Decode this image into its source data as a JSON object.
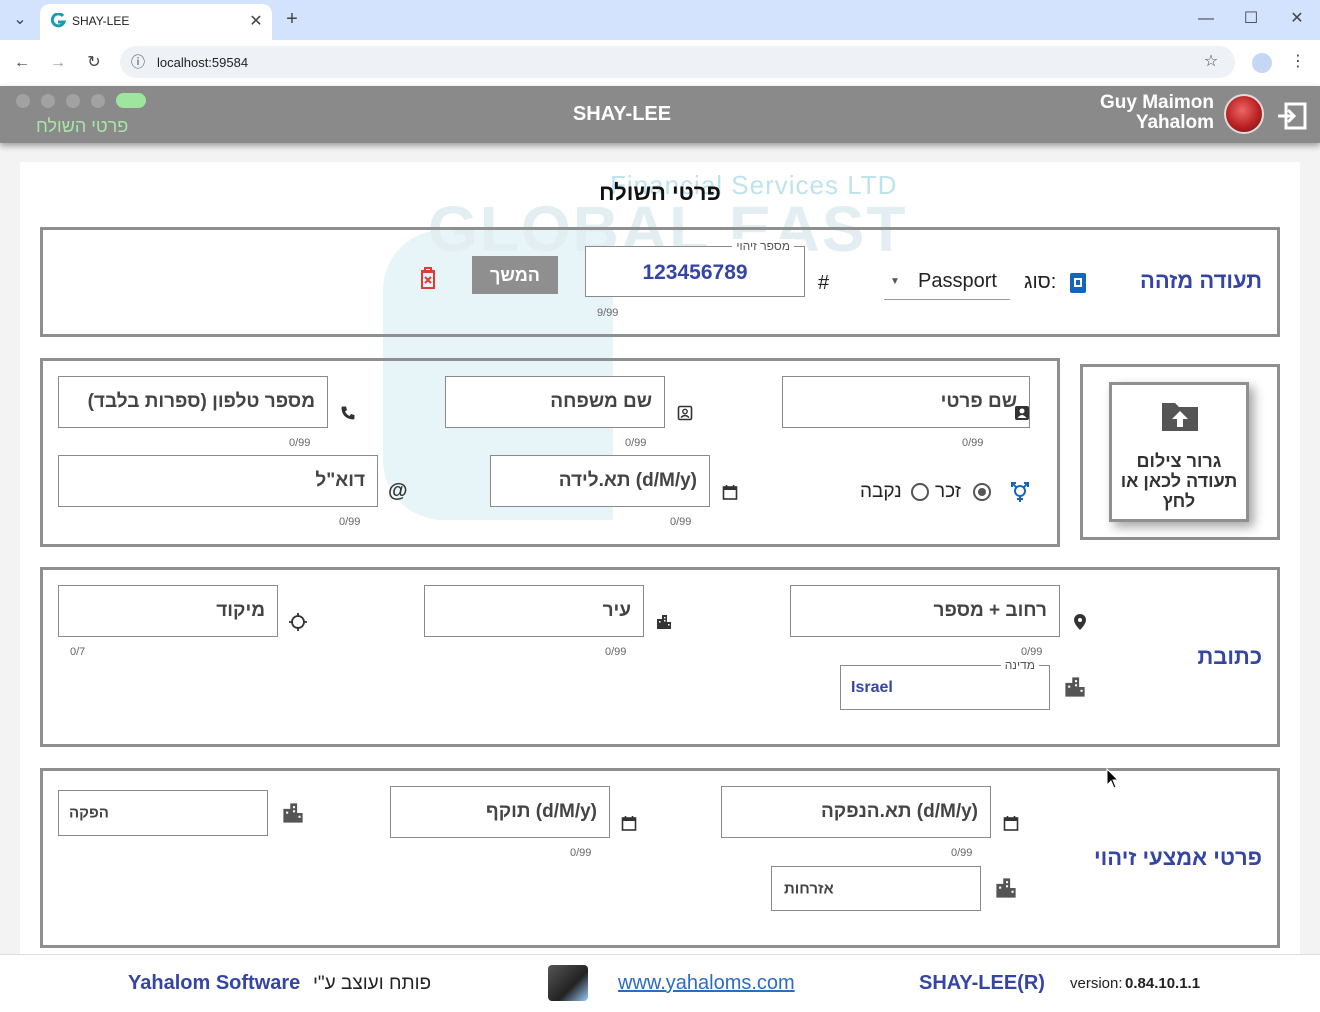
{
  "browser": {
    "tab_title": "SHAY-LEE",
    "url": "localhost:59584"
  },
  "header": {
    "page_subtitle": "פרטי השולח",
    "app_title": "SHAY-LEE",
    "user_first": "Guy Maimon",
    "user_last": "Yahalom"
  },
  "watermark": {
    "line1": "Financial Services LTD",
    "line2": "GLOBAL EAST"
  },
  "main_title": "פרטי השולח",
  "id_section": {
    "label": "תעודה מזהה",
    "type_label": "סוג:",
    "type_value": "Passport",
    "hash": "#",
    "id_legend": "מספר זיהוי",
    "id_value": "123456789",
    "id_counter": "9/99",
    "continue": "המשך"
  },
  "personal": {
    "first_name": "שם פרטי",
    "first_counter": "0/99",
    "last_name": "שם משפחה",
    "last_counter": "0/99",
    "phone": "מספר טלפון (ספרות בלבד)",
    "phone_counter": "0/99",
    "male": "זכר",
    "female": "נקבה",
    "birthdate": "תא.לידה (d/M/y)",
    "birth_counter": "0/99",
    "email": "דוא\"ל",
    "email_counter": "0/99"
  },
  "upload": {
    "text": "גרור צילום תעודה לכאן או לחץ"
  },
  "address": {
    "label": "כתובת",
    "street": "רחוב + מספר",
    "street_counter": "0/99",
    "city": "עיר",
    "city_counter": "0/99",
    "zip": "מיקוד",
    "zip_counter": "0/7",
    "country_legend": "מדינה",
    "country_value": "Israel"
  },
  "id_means": {
    "label": "פרטי אמצעי זיהוי",
    "issue_date": "תא.הנפקה (d/M/y)",
    "issue_counter": "0/99",
    "expiry": "תוקף (d/M/y)",
    "expiry_counter": "0/99",
    "issuer": "הפקה",
    "citizenship": "אזרחות"
  },
  "footer": {
    "dev_text": "פותח ועוצב ע\"י",
    "company": "Yahalom Software",
    "website": "www.yahaloms.com",
    "product": "SHAY-LEE(R)",
    "version_label": "version:",
    "version": "0.84.10.1.1"
  }
}
